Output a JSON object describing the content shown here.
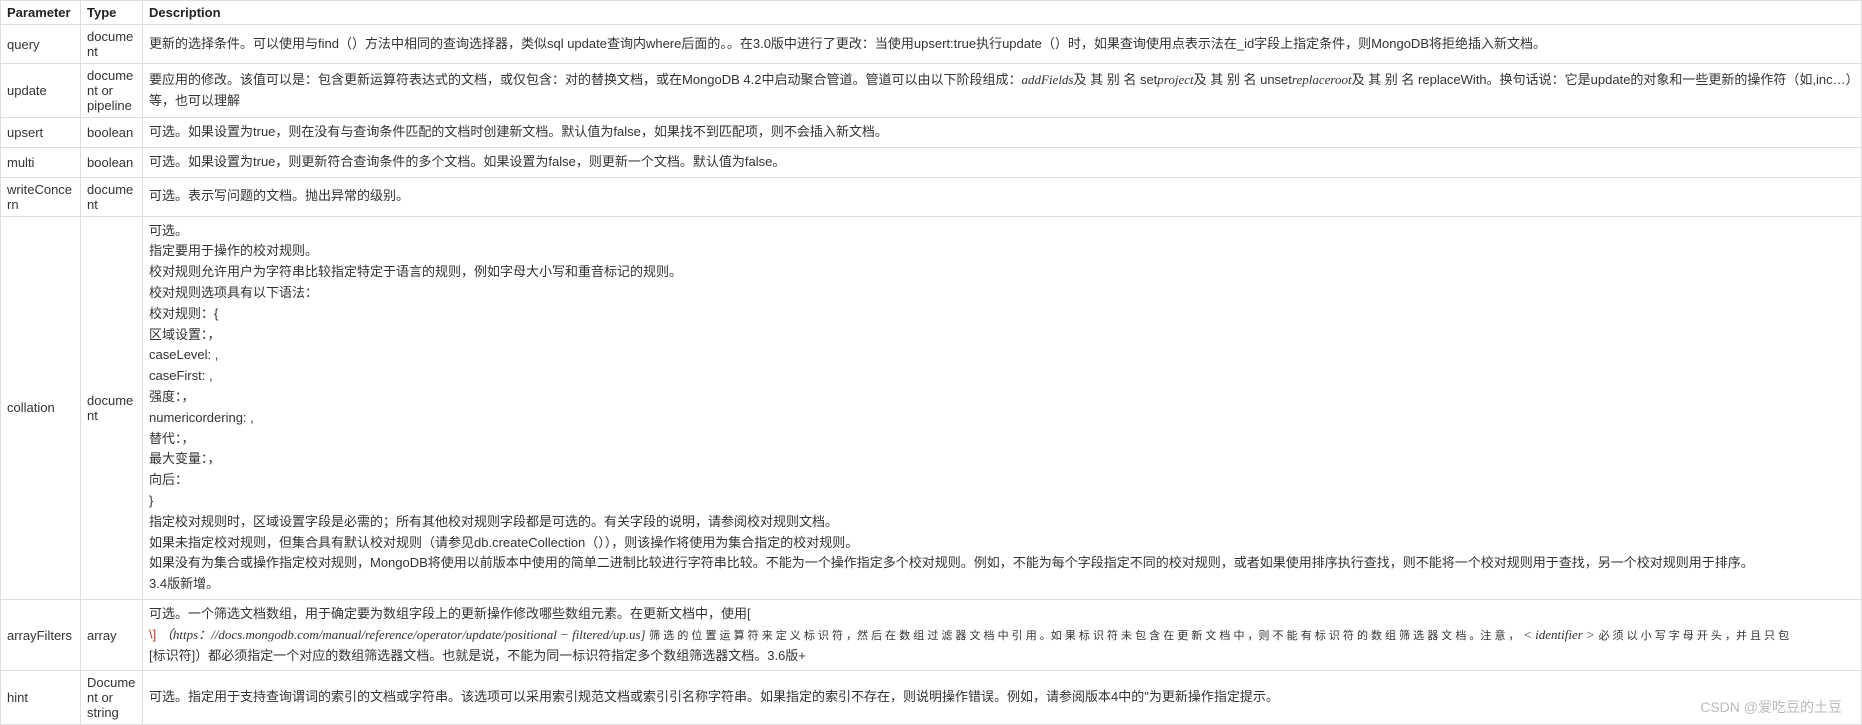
{
  "headers": {
    "parameter": "Parameter",
    "type": "Type",
    "description": "Description"
  },
  "rows": [
    {
      "parameter": "query",
      "type": "document",
      "description": "更新的选择条件。可以使用与find（）方法中相同的查询选择器，类似sql update查询内where后面的。。在3.0版中进行了更改：当使用upsert:true执行update（）时，如果查询使用点表示法在_id字段上指定条件，则MongoDB将拒绝插入新文档。"
    },
    {
      "parameter": "update",
      "type": "document or pipeline",
      "desc_prefix": "要应用的修改。该值可以是：包含更新运算符表达式的文档，或仅包含：对的替换文档，或在MongoDB 4.2中启动聚合管道。管道可以由以下阶段组成：",
      "s1": "addFields",
      "t1": "及 其 别 名 set",
      "s2": "project",
      "t2": "及 其 别 名 unset",
      "s3": "replaceroot",
      "t3": "及 其 别 名 replaceWith。换句话说：它是update的对象和一些更新的操作符（如,inc…）等，也可以理解"
    },
    {
      "parameter": "upsert",
      "type": "boolean",
      "description": "可选。如果设置为true，则在没有与查询条件匹配的文档时创建新文档。默认值为false，如果找不到匹配项，则不会插入新文档。"
    },
    {
      "parameter": "multi",
      "type": "boolean",
      "description": "可选。如果设置为true，则更新符合查询条件的多个文档。如果设置为false，则更新一个文档。默认值为false。"
    },
    {
      "parameter": "writeConcern",
      "type": "document",
      "description": "可选。表示写问题的文档。抛出异常的级别。"
    },
    {
      "parameter": "collation",
      "type": "document",
      "description": "可选。\n指定要用于操作的校对规则。\n校对规则允许用户为字符串比较指定特定于语言的规则，例如字母大小写和重音标记的规则。\n校对规则选项具有以下语法：\n校对规则：{\n区域设置：，\ncaseLevel: ,\ncaseFirst: ,\n强度：，\nnumericordering: ,\n替代：，\n最大变量：，\n向后：\n}\n指定校对规则时，区域设置字段是必需的；所有其他校对规则字段都是可选的。有关字段的说明，请参阅校对规则文档。\n如果未指定校对规则，但集合具有默认校对规则（请参见db.createCollection（）），则该操作将使用为集合指定的校对规则。\n如果没有为集合或操作指定校对规则，MongoDB将使用以前版本中使用的简单二进制比较进行字符串比较。不能为一个操作指定多个校对规则。例如，不能为每个字段指定不同的校对规则，或者如果使用排序执行查找，则不能将一个校对规则用于查找，另一个校对规则用于排序。\n3.4版新增。"
    },
    {
      "parameter": "arrayFilters",
      "type": "array",
      "line1": "可选。一个筛选文档数组，用于确定要为数组字段上的更新操作修改哪些数组元素。在更新文档中，使用[",
      "slash": "\\]",
      "url": "（https：//docs.mongodb.com/manual/reference/operator/update/positional − filtered/up.us]",
      "tail1": "筛 选 的 位 置 运 算 符 来 定 义 标 识 符 ，然 后 在 数 组 过 滤 器 文 档 中 引 用 。如 果 标 识 符 未 包 含 在 更 新 文 档 中 ，则 不 能 有 标 识 符 的 数 组 筛 选 器 文 档 。注 意 ，",
      "ident": "< identifier >",
      "tail2": " 必 须 以 小 写 字 母 开 头 ，并 且 只 包",
      "line3": "[标识符]）都必须指定一个对应的数组筛选器文档。也就是说，不能为同一标识符指定多个数组筛选器文档。3.6版+"
    },
    {
      "parameter": "hint",
      "type": "Document or string",
      "description": "可选。指定用于支持查询谓词的索引的文档或字符串。该选项可以采用索引规范文档或索引引名称字符串。如果指定的索引不存在，则说明操作错误。例如，请参阅版本4中的\"为更新操作指定提示。"
    }
  ],
  "watermark": "CSDN @爱吃豆的土豆"
}
